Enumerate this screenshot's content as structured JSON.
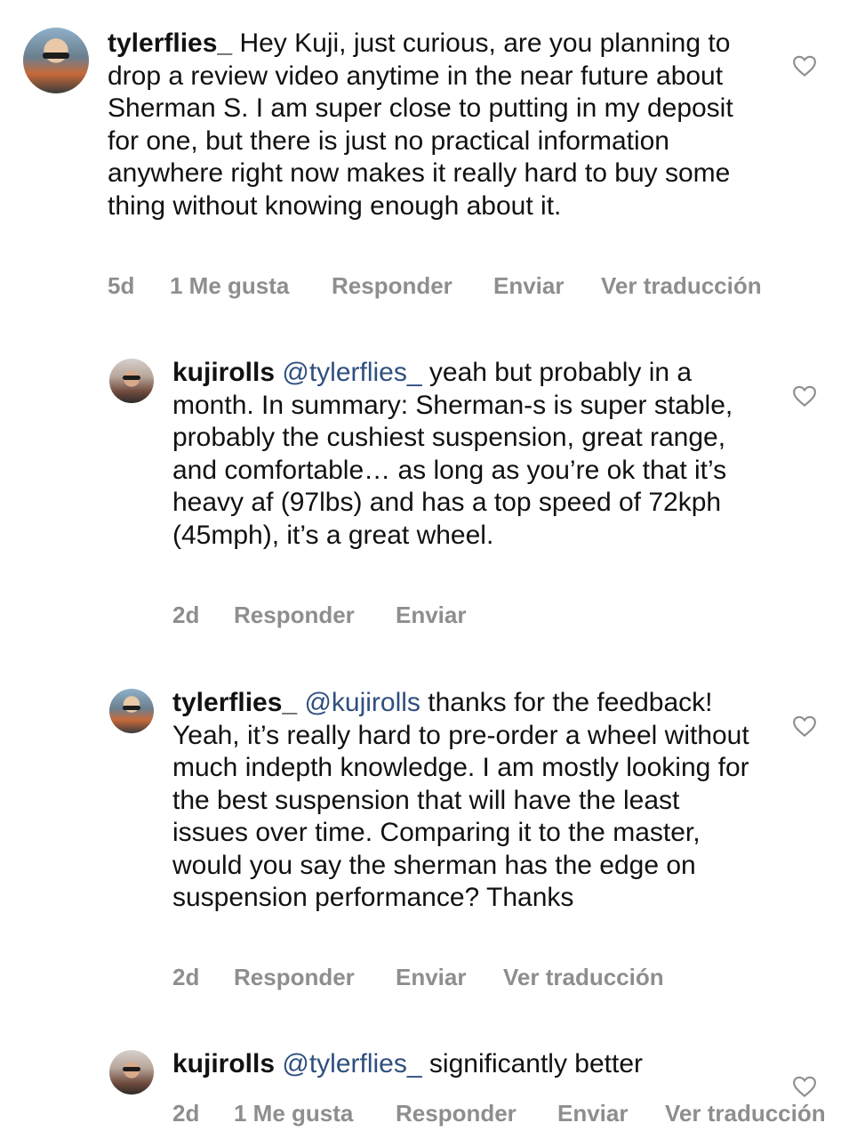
{
  "comments": [
    {
      "username": "tylerflies_",
      "mention": "",
      "text": "Hey Kuji, just curious, are you planning to drop a review video anytime in the near future about Sherman S. I am super close to putting in my deposit for one, but there is just no practical information anywhere right now makes it really hard to buy some thing without knowing enough about it.",
      "time": "5d",
      "likes": "1 Me gusta",
      "reply": "Responder",
      "send": "Enviar",
      "translate": "Ver traducción"
    },
    {
      "username": "kujirolls",
      "mention": "@tylerflies_",
      "text": "yeah but probably in a month. In summary: Sherman-s is super stable, probably the cushiest suspension, great range, and comfortable… as long as you’re ok that it’s heavy af (97lbs) and has a top speed of 72kph (45mph), it’s a great wheel.",
      "time": "2d",
      "reply": "Responder",
      "send": "Enviar"
    },
    {
      "username": "tylerflies_",
      "mention": "@kujirolls",
      "text": "thanks for the feedback! Yeah, it’s really hard to pre-order a wheel without much indepth knowledge. I am mostly looking for the best suspension that will have the least issues over time. Comparing it to the master, would you say the sherman has the edge on suspension performance? Thanks",
      "time": "2d",
      "reply": "Responder",
      "send": "Enviar",
      "translate": "Ver traducción"
    },
    {
      "username": "kujirolls",
      "mention": "@tylerflies_",
      "text": "significantly better",
      "time": "2d",
      "likes": "1 Me gusta",
      "reply": "Responder",
      "send": "Enviar",
      "translate": "Ver traducción"
    }
  ]
}
